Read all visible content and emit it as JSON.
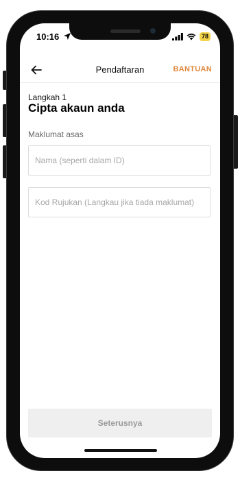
{
  "status_bar": {
    "time": "10:16",
    "battery": "78",
    "icons": [
      "location-arrow-icon",
      "signal-icon",
      "wifi-icon",
      "battery-icon"
    ]
  },
  "nav": {
    "back_icon": "arrow-left-icon",
    "title": "Pendaftaran",
    "help_label": "BANTUAN"
  },
  "content": {
    "step_label": "Langkah 1",
    "title": "Cipta akaun anda",
    "section_label": "Maklumat asas",
    "name_field": {
      "value": "",
      "placeholder": "Nama (seperti dalam ID)"
    },
    "referral_field": {
      "value": "",
      "placeholder": "Kod Rujukan (Langkau jika tiada maklumat)"
    }
  },
  "footer": {
    "next_label": "Seterusnya"
  },
  "colors": {
    "accent": "#e0863b",
    "battery_badge": "#f3d34a",
    "disabled_button_bg": "#efefef",
    "disabled_button_text": "#9a9a9a"
  }
}
